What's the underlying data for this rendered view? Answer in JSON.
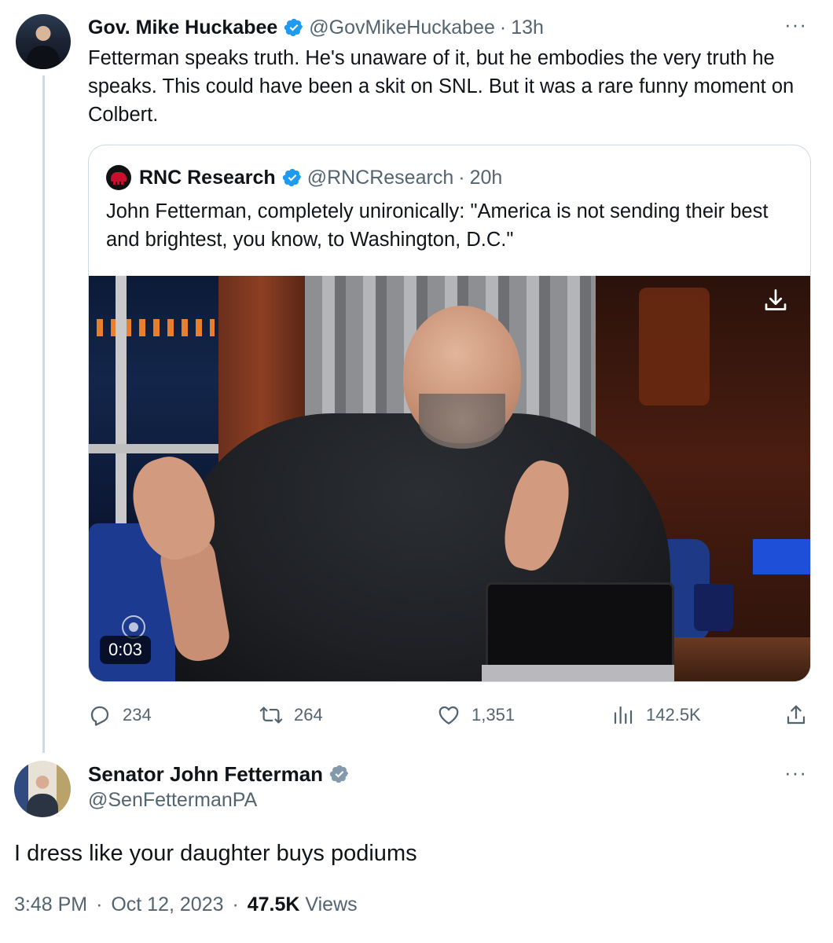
{
  "tweet1": {
    "display_name": "Gov. Mike Huckabee",
    "handle": "@GovMikeHuckabee",
    "time_sep": "·",
    "time": "13h",
    "more": "···",
    "text": "Fetterman speaks truth.  He's unaware of it, but he embodies the very truth he speaks.  This could have been a skit on SNL.  But it was a rare funny moment on Colbert.",
    "quote": {
      "display_name": "RNC Research",
      "handle": "@RNCResearch",
      "time_sep": "·",
      "time": "20h",
      "text": "John Fetterman, completely unironically: \"America is not sending their best and brightest, you know, to Washington, D.C.\"",
      "video_duration": "0:03"
    },
    "actions": {
      "replies": "234",
      "reposts": "264",
      "likes": "1,351",
      "views": "142.5K"
    }
  },
  "tweet2": {
    "display_name": "Senator John Fetterman",
    "handle": "@SenFettermanPA",
    "more": "···",
    "text": "I dress like your daughter buys podiums",
    "time": "3:48 PM",
    "sep1": "·",
    "date": "Oct 12, 2023",
    "sep2": "·",
    "views_count": "47.5K",
    "views_label": "Views"
  },
  "colors": {
    "verified_blue": "#1d9bf0",
    "verified_gray": "#829aab",
    "muted_text": "#536471",
    "border": "#cfd9de"
  },
  "icons": [
    "verified-badge-icon",
    "reply-icon",
    "repost-icon",
    "like-icon",
    "views-icon",
    "share-icon",
    "download-icon",
    "cbs-eye-icon",
    "more-icon"
  ]
}
